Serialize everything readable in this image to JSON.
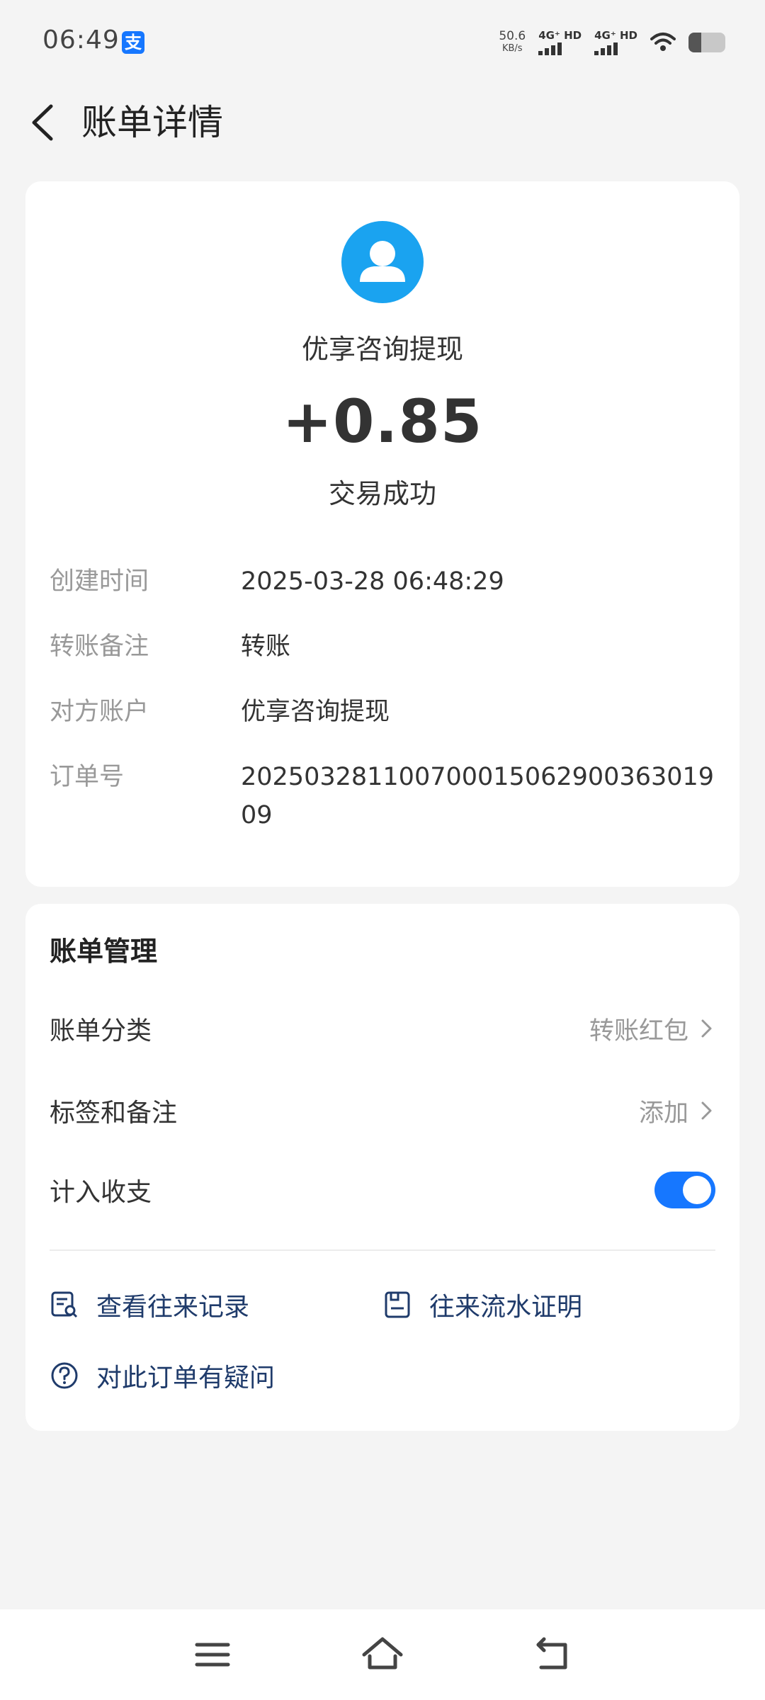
{
  "status_bar": {
    "time": "06:49",
    "app_badge": "支",
    "net_speed_value": "50.6",
    "net_speed_unit": "KB/s",
    "sim1_label": "4G⁺ HD",
    "sim2_label": "4G⁺ HD",
    "battery_level": 0.35
  },
  "header": {
    "title": "账单详情"
  },
  "transaction": {
    "payee": "优享咨询提现",
    "amount": "+0.85",
    "status": "交易成功",
    "avatar_color": "#1aa3f0"
  },
  "details": [
    {
      "label": "创建时间",
      "value": "2025-03-28 06:48:29"
    },
    {
      "label": "转账备注",
      "value": "转账"
    },
    {
      "label": "对方账户",
      "value": "优享咨询提现"
    },
    {
      "label": "订单号",
      "value": "20250328110070001506290036301909"
    }
  ],
  "manage": {
    "title": "账单管理",
    "category_label": "账单分类",
    "category_value": "转账红包",
    "tags_label": "标签和备注",
    "tags_value": "添加",
    "include_label": "计入收支",
    "include_enabled": true,
    "accent": "#1677ff",
    "link_history": "查看往来记录",
    "link_statement": "往来流水证明",
    "link_question": "对此订单有疑问"
  }
}
